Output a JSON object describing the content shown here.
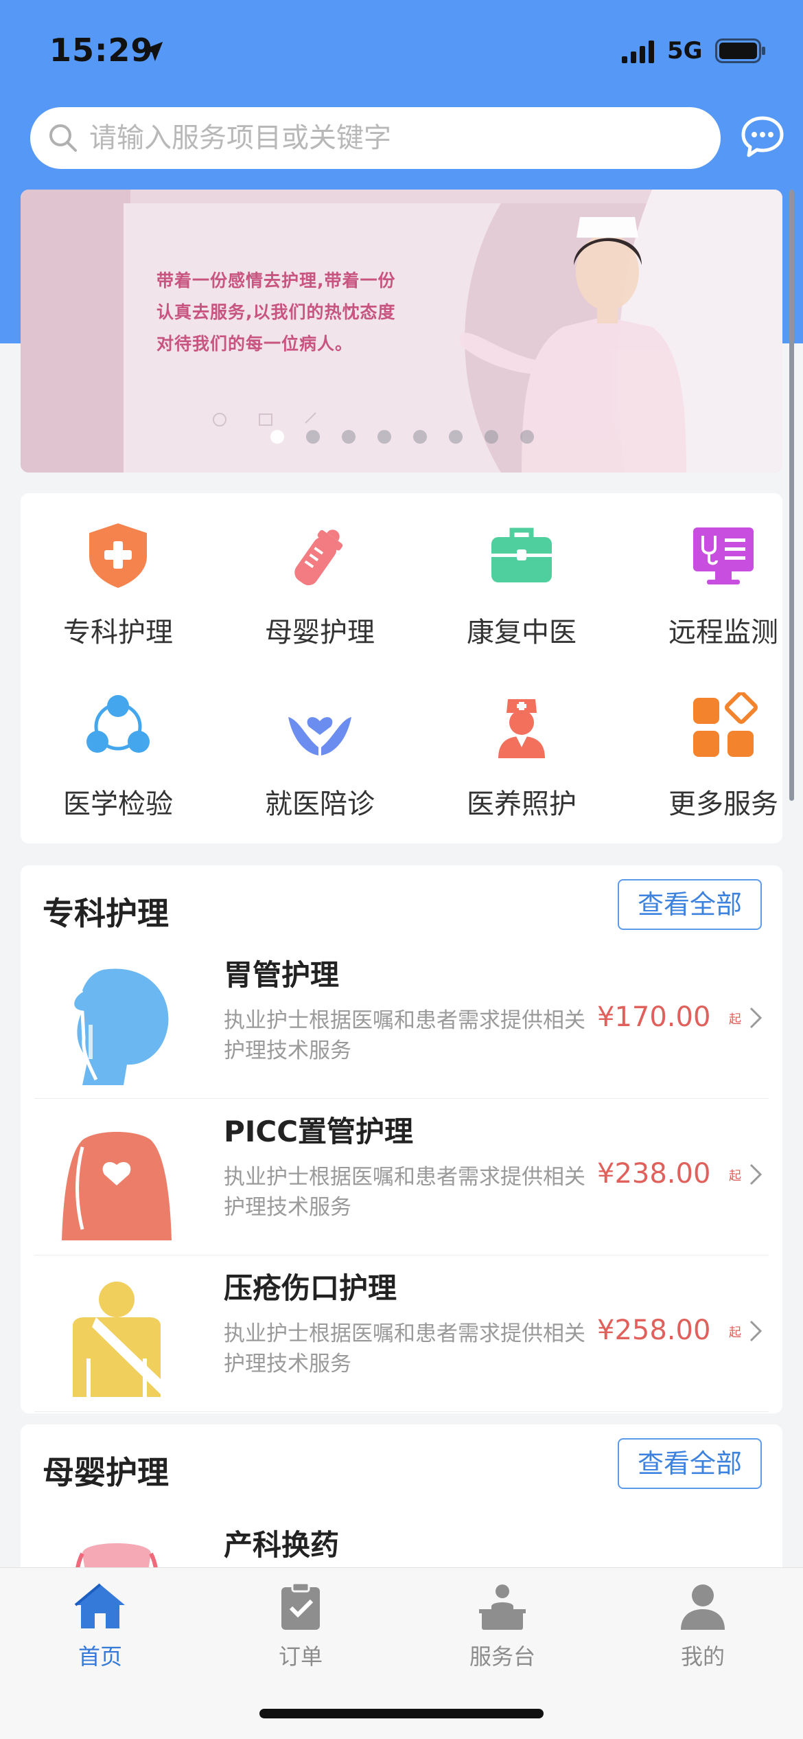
{
  "status_bar": {
    "time": "15:29",
    "network": "5G"
  },
  "search": {
    "placeholder": "请输入服务项目或关键字"
  },
  "banner": {
    "text_lines": [
      "带着一份感情去护理,带着一份",
      "认真去服务,以我们的热忱态度",
      "对待我们的每一位病人。"
    ],
    "dots_total": 8,
    "active_dot": 1
  },
  "grid": {
    "items": [
      {
        "label": "专科护理",
        "icon": "shield-plus-icon",
        "color": "#f4834e"
      },
      {
        "label": "母婴护理",
        "icon": "baby-bottle-icon",
        "color": "#f37b82"
      },
      {
        "label": "康复中医",
        "icon": "medical-kit-icon",
        "color": "#4fcf9e"
      },
      {
        "label": "远程监测",
        "icon": "monitor-stethoscope-icon",
        "color": "#c84ee0"
      },
      {
        "label": "医学检验",
        "icon": "lab-network-icon",
        "color": "#44a6ec"
      },
      {
        "label": "就医陪诊",
        "icon": "hands-heart-icon",
        "color": "#6c8df0"
      },
      {
        "label": "医养照护",
        "icon": "nurse-icon",
        "color": "#f2705c"
      },
      {
        "label": "更多服务",
        "icon": "more-grid-icon",
        "color": "#f4832e"
      }
    ]
  },
  "sections": [
    {
      "title": "专科护理",
      "view_all": "查看全部",
      "items": [
        {
          "name": "胃管护理",
          "desc": "执业护士根据医嘱和患者需求提供相关护理技术服务",
          "price": "¥170.00",
          "unit": "起",
          "icon": "head-tube-icon"
        },
        {
          "name": "PICC置管护理",
          "desc": "执业护士根据医嘱和患者需求提供相关护理技术服务",
          "price": "¥238.00",
          "unit": "起",
          "icon": "torso-picc-icon"
        },
        {
          "name": "压疮伤口护理",
          "desc": "执业护士根据医嘱和患者需求提供相关护理技术服务",
          "price": "¥258.00",
          "unit": "起",
          "icon": "bandaged-person-icon"
        }
      ]
    },
    {
      "title": "母婴护理",
      "view_all": "查看全部",
      "items": [
        {
          "name": "产科换药",
          "icon": "pelvis-icon"
        }
      ]
    }
  ],
  "tabbar": {
    "tabs": [
      {
        "label": "首页",
        "icon": "home-icon",
        "active": true
      },
      {
        "label": "订单",
        "icon": "clipboard-check-icon",
        "active": false
      },
      {
        "label": "服务台",
        "icon": "service-desk-icon",
        "active": false
      },
      {
        "label": "我的",
        "icon": "user-icon",
        "active": false
      }
    ]
  },
  "colors": {
    "header": "#5598f6",
    "accent": "#3579d9",
    "price": "#e0605c"
  }
}
